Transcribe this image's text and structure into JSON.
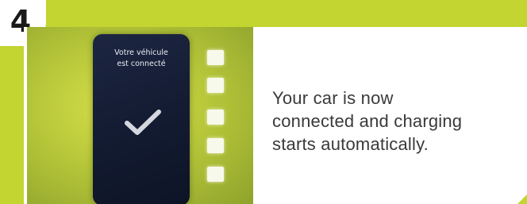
{
  "step": {
    "number": "4"
  },
  "photo": {
    "screen_text_line1": "Votre véhicule",
    "screen_text_line2": "est connecté",
    "screen_icon": "check-icon",
    "indicator_count": 5
  },
  "caption": {
    "line1": "Your car is now",
    "line2": "connected and charging",
    "line3": "starts automatically."
  },
  "colors": {
    "accent": "#c2d530",
    "screen": "#141c34",
    "text": "#3a3a3a"
  }
}
